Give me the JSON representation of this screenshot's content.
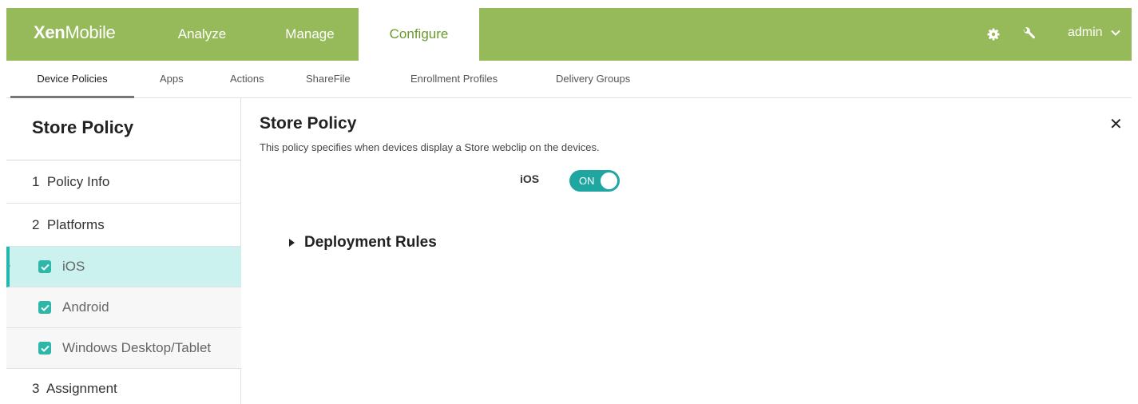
{
  "app": {
    "logo_bold": "Xen",
    "logo_thin": "Mobile"
  },
  "topnav": {
    "tabs": [
      {
        "label": "Analyze"
      },
      {
        "label": "Manage"
      },
      {
        "label": "Configure",
        "active": true
      }
    ],
    "user": "admin"
  },
  "subnav": {
    "tabs": [
      {
        "label": "Device Policies",
        "active": true
      },
      {
        "label": "Apps"
      },
      {
        "label": "Actions"
      },
      {
        "label": "ShareFile"
      },
      {
        "label": "Enrollment Profiles"
      },
      {
        "label": "Delivery Groups"
      }
    ]
  },
  "sidebar": {
    "title": "Store Policy",
    "steps": [
      {
        "label": "1  Policy Info"
      },
      {
        "label": "2  Platforms"
      },
      {
        "label": "iOS",
        "checked": true,
        "selected": true
      },
      {
        "label": "Android",
        "checked": true
      },
      {
        "label": "Windows Desktop/Tablet",
        "checked": true
      },
      {
        "label": "3  Assignment"
      }
    ]
  },
  "main": {
    "title": "Store Policy",
    "description": "This policy specifies when devices display a Store webclip on the devices.",
    "ios_label": "iOS",
    "ios_toggle": "ON",
    "deployment_rules": "Deployment Rules"
  },
  "colors": {
    "header": "#96b95a",
    "accent": "#25b7ad",
    "selected_row": "#ccf2ef"
  }
}
